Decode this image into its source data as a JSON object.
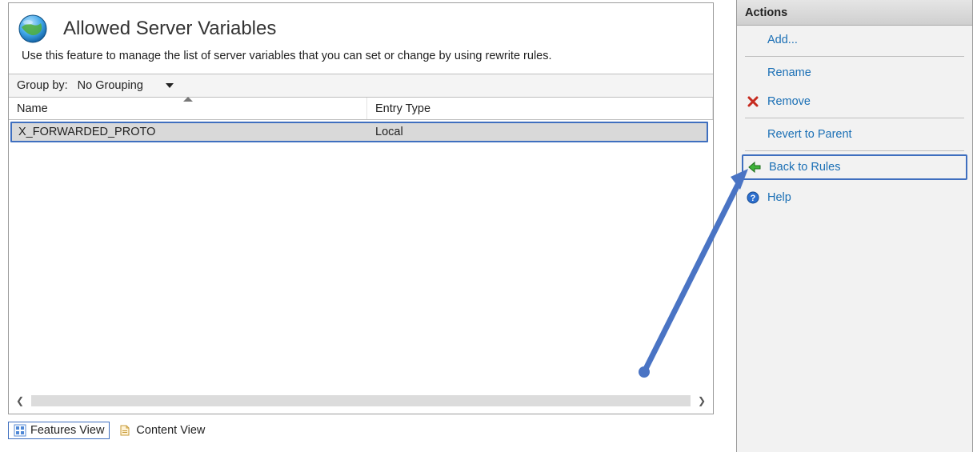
{
  "page": {
    "title": "Allowed Server Variables",
    "description": "Use this feature to manage the list of server variables that you can set or change by using rewrite rules."
  },
  "group_by": {
    "label": "Group by:",
    "selected": "No Grouping"
  },
  "columns": {
    "name": "Name",
    "entry_type": "Entry Type"
  },
  "rows": [
    {
      "name": "X_FORWARDED_PROTO",
      "entry_type": "Local"
    }
  ],
  "tabs": {
    "features_view": "Features View",
    "content_view": "Content View"
  },
  "actions": {
    "header": "Actions",
    "add": "Add...",
    "rename": "Rename",
    "remove": "Remove",
    "revert": "Revert to Parent",
    "back_to_rules": "Back to Rules",
    "help": "Help"
  }
}
